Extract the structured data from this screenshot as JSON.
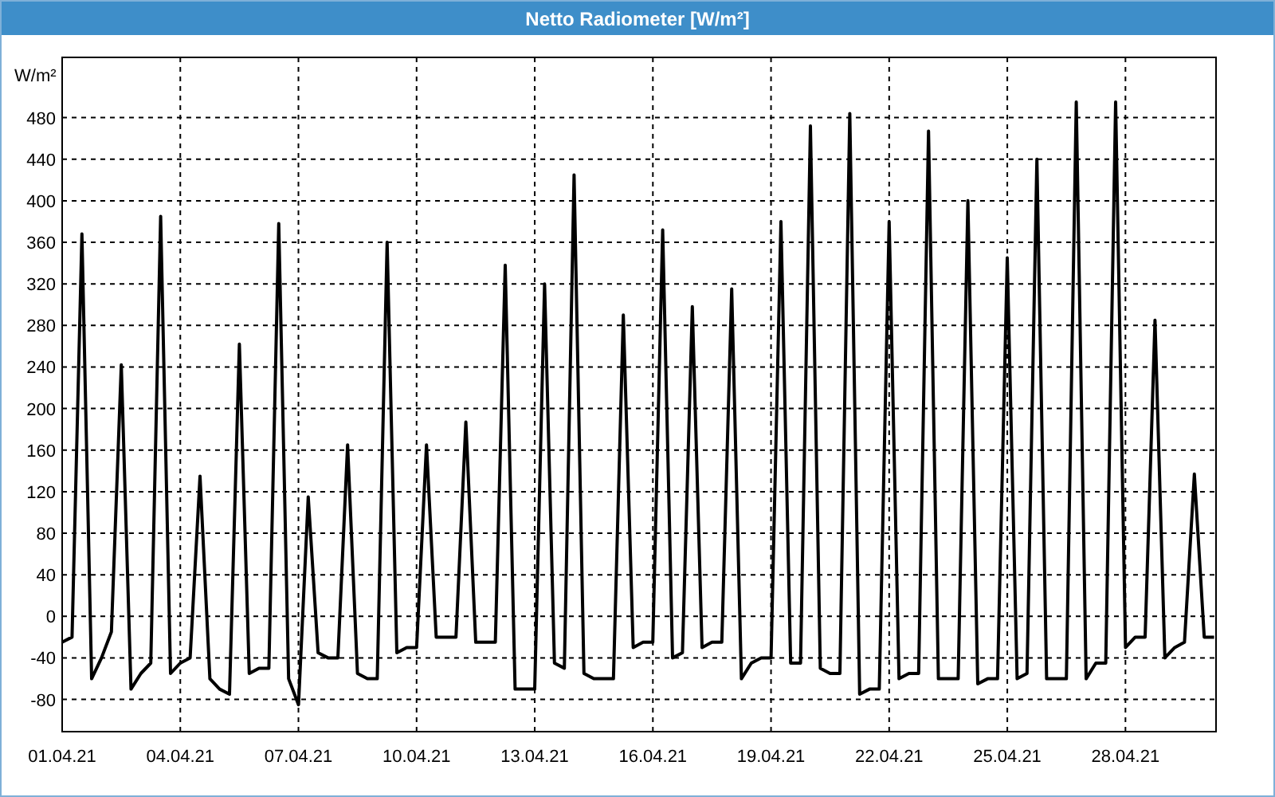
{
  "window": {
    "title": "Netto Radiometer [W/m²]"
  },
  "chart": {
    "chart_data": {
      "type": "line",
      "grid": true,
      "ylabel": "W/m²",
      "ylim": [
        -111,
        538
      ],
      "yticks": [
        -80,
        -40,
        0,
        40,
        80,
        120,
        160,
        200,
        240,
        280,
        320,
        360,
        400,
        440,
        480
      ],
      "categories": [
        "01.04.21",
        null,
        null,
        null,
        null,
        null,
        null,
        null,
        null,
        null,
        null,
        null,
        "04.04.21",
        null,
        null,
        null,
        null,
        null,
        null,
        null,
        null,
        null,
        null,
        null,
        "07.04.21",
        null,
        null,
        null,
        null,
        null,
        null,
        null,
        null,
        null,
        null,
        null,
        "10.04.21",
        null,
        null,
        null,
        null,
        null,
        null,
        null,
        null,
        null,
        null,
        null,
        "13.04.21",
        null,
        null,
        null,
        null,
        null,
        null,
        null,
        null,
        null,
        null,
        null,
        "16.04.21",
        null,
        null,
        null,
        null,
        null,
        null,
        null,
        null,
        null,
        null,
        null,
        "19.04.21",
        null,
        null,
        null,
        null,
        null,
        null,
        null,
        null,
        null,
        null,
        null,
        "22.04.21",
        null,
        null,
        null,
        null,
        null,
        null,
        null,
        null,
        null,
        null,
        null,
        "25.04.21",
        null,
        null,
        null,
        null,
        null,
        null,
        null,
        null,
        null,
        null,
        null,
        "28.04.21",
        null,
        null,
        null,
        null,
        null,
        null,
        null,
        null,
        null
      ],
      "series": [
        {
          "color": "#000000",
          "values": [
            -25,
            -20,
            368,
            -60,
            -40,
            -15,
            242,
            -70,
            -55,
            -45,
            385,
            -55,
            -45,
            -40,
            135,
            -60,
            -70,
            -75,
            262,
            -55,
            -50,
            -50,
            378,
            -60,
            -85,
            115,
            -35,
            -40,
            -40,
            165,
            -55,
            -60,
            -60,
            360,
            -35,
            -30,
            -30,
            165,
            -20,
            -20,
            -20,
            187,
            -25,
            -25,
            -25,
            338,
            -70,
            -70,
            -70,
            320,
            -45,
            -50,
            425,
            -55,
            -60,
            -60,
            -60,
            290,
            -30,
            -25,
            -25,
            372,
            -40,
            -35,
            298,
            -30,
            -25,
            -25,
            315,
            -60,
            -45,
            -40,
            -40,
            380,
            -45,
            -45,
            472,
            -50,
            -55,
            -55,
            484,
            -75,
            -70,
            -70,
            380,
            -60,
            -55,
            -55,
            467,
            -60,
            -60,
            -60,
            400,
            -65,
            -60,
            -60,
            345,
            -60,
            -55,
            440,
            -60,
            -60,
            -60,
            495,
            -60,
            -45,
            -45,
            495,
            -30,
            -20,
            -20,
            285,
            -40,
            -30,
            -25,
            137,
            -20,
            -20
          ]
        }
      ]
    }
  }
}
